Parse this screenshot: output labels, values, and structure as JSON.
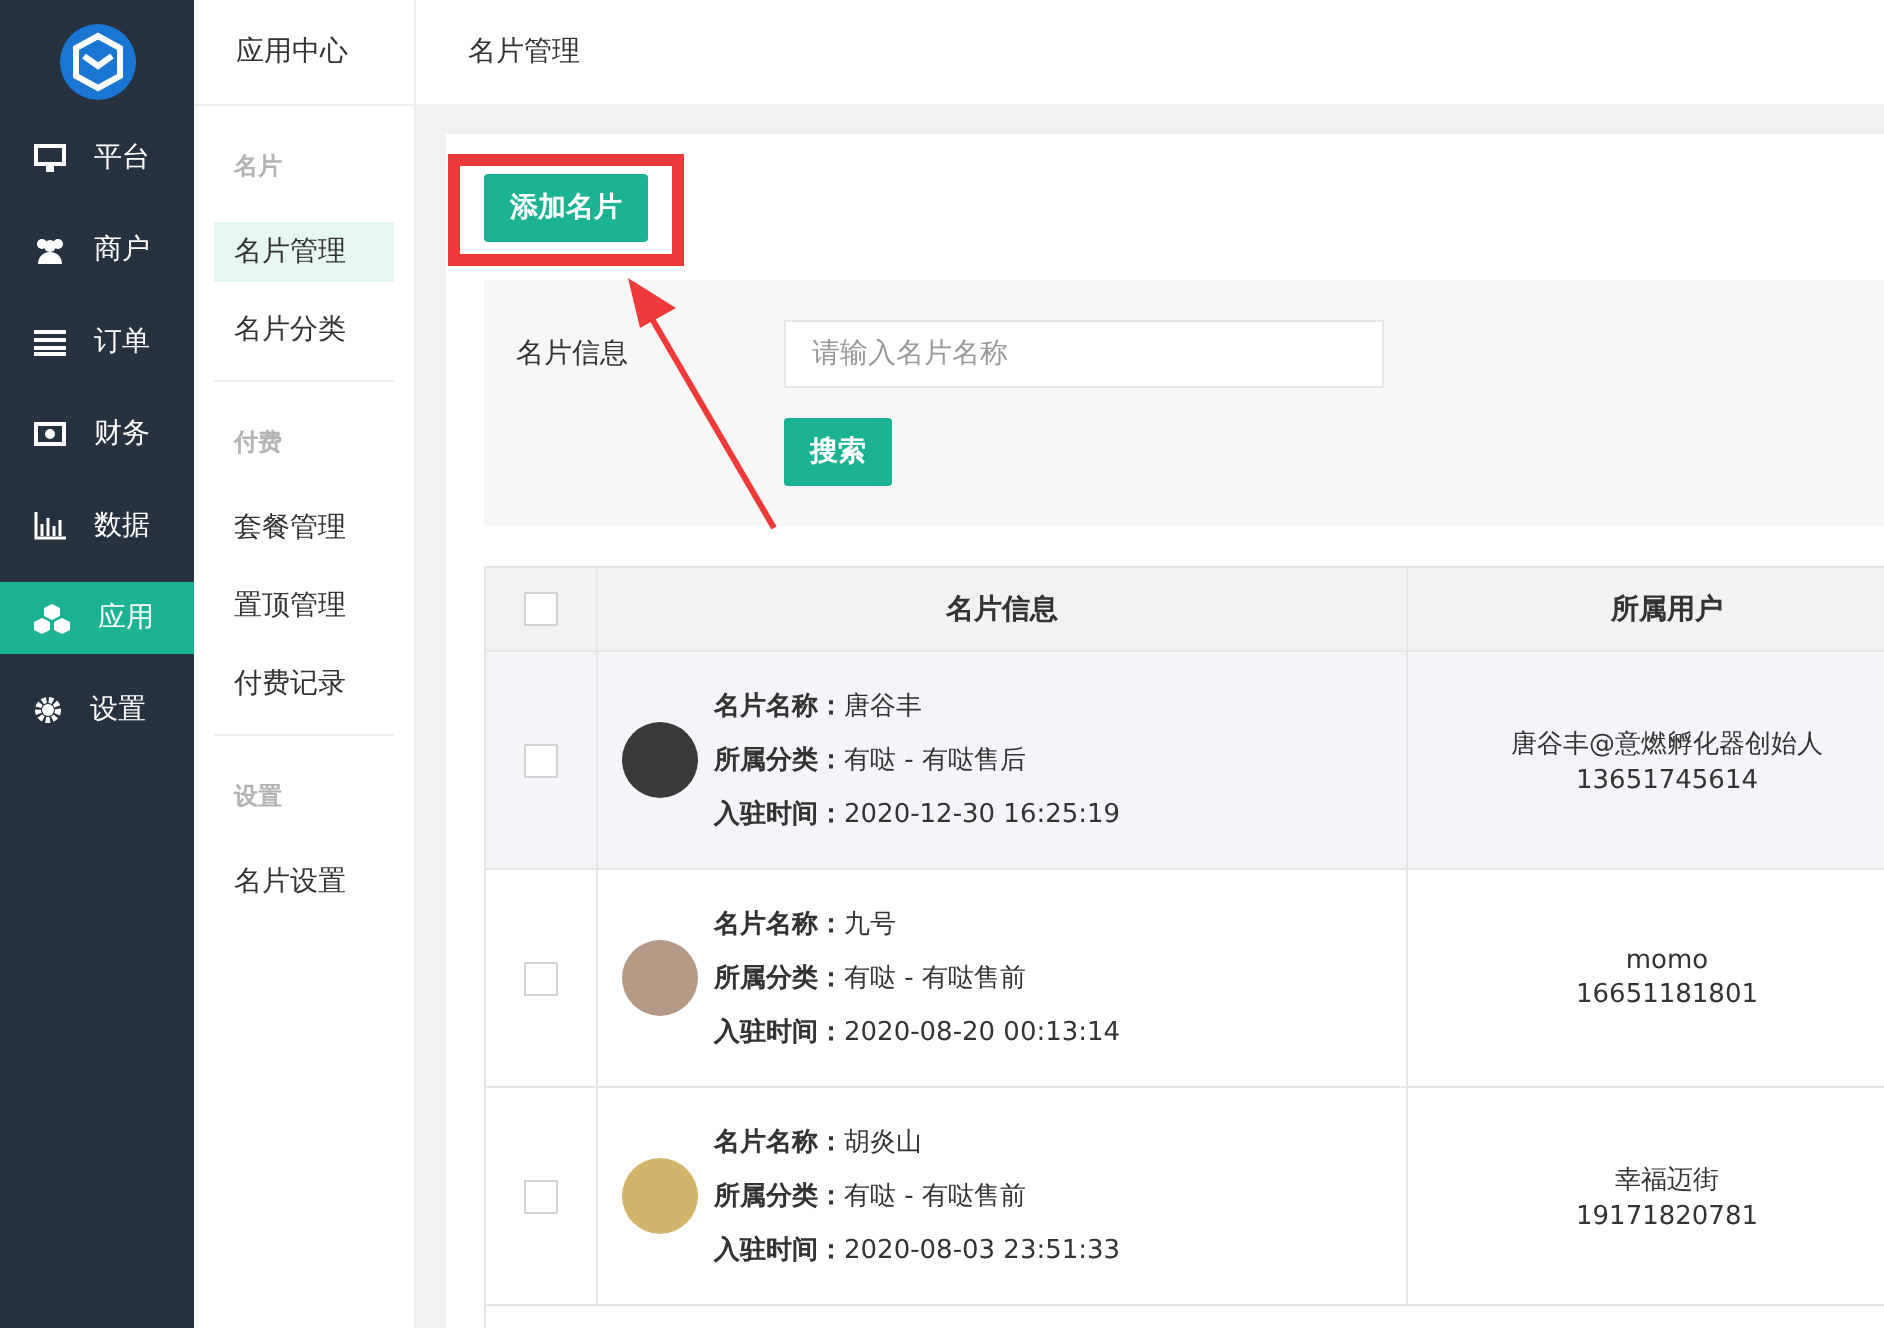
{
  "nav": {
    "items": [
      {
        "label": "平台",
        "selected": false
      },
      {
        "label": "商户",
        "selected": false
      },
      {
        "label": "订单",
        "selected": false
      },
      {
        "label": "财务",
        "selected": false
      },
      {
        "label": "数据",
        "selected": false
      },
      {
        "label": "应用",
        "selected": true
      },
      {
        "label": "设置",
        "selected": false
      }
    ]
  },
  "subnav": {
    "title": "应用中心",
    "groups": [
      {
        "heading": "名片",
        "items": [
          {
            "label": "名片管理",
            "selected": true
          },
          {
            "label": "名片分类",
            "selected": false
          }
        ]
      },
      {
        "heading": "付费",
        "items": [
          {
            "label": "套餐管理",
            "selected": false
          },
          {
            "label": "置顶管理",
            "selected": false
          },
          {
            "label": "付费记录",
            "selected": false
          }
        ]
      },
      {
        "heading": "设置",
        "items": [
          {
            "label": "名片设置",
            "selected": false
          }
        ]
      }
    ]
  },
  "breadcrumb": "名片管理",
  "add_button": "添加名片",
  "filter": {
    "label": "名片信息",
    "placeholder": "请输入名片名称",
    "search_button": "搜索"
  },
  "table": {
    "select_all_checked": false,
    "columns": [
      "名片信息",
      "所属用户"
    ],
    "rows": [
      {
        "checked": false,
        "highlighted": true,
        "fields": [
          {
            "label": "名片名称：",
            "value": "唐谷丰"
          },
          {
            "label": "所属分类：",
            "value": "有哒 - 有哒售后"
          },
          {
            "label": "入驻时间：",
            "value": "2020-12-30 16:25:19"
          }
        ],
        "user": "唐谷丰@意燃孵化器创始人",
        "phone": "13651745614"
      },
      {
        "checked": false,
        "highlighted": false,
        "fields": [
          {
            "label": "名片名称：",
            "value": "九号"
          },
          {
            "label": "所属分类：",
            "value": "有哒 - 有哒售前"
          },
          {
            "label": "入驻时间：",
            "value": "2020-08-20 00:13:14"
          }
        ],
        "user": "momo",
        "phone": "16651181801"
      },
      {
        "checked": false,
        "highlighted": false,
        "fields": [
          {
            "label": "名片名称：",
            "value": "胡炎山"
          },
          {
            "label": "所属分类：",
            "value": "有哒 - 有哒售前"
          },
          {
            "label": "入驻时间：",
            "value": "2020-08-03 23:51:33"
          }
        ],
        "user": "幸福迈街",
        "phone": "19171820781"
      }
    ]
  }
}
